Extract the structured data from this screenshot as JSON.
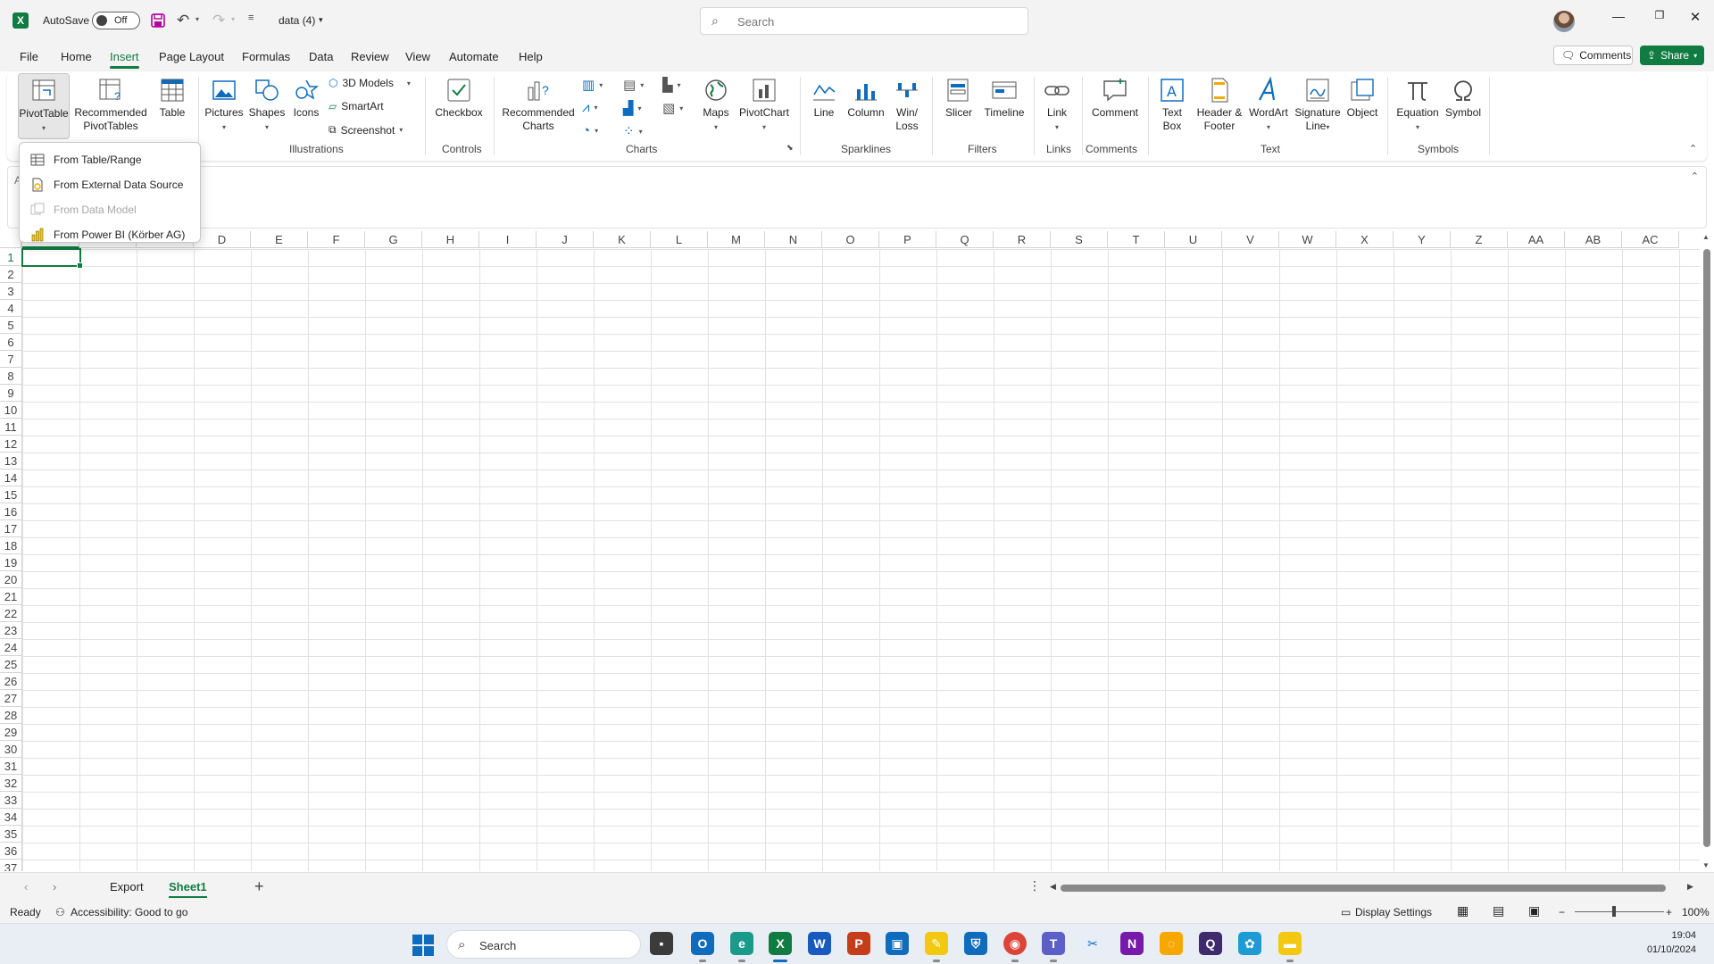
{
  "titlebar": {
    "app_icon_letter": "X",
    "autosave_label": "AutoSave",
    "autosave_state": "Off",
    "document_title": "data (4)",
    "search_placeholder": "Search"
  },
  "menu": {
    "tabs": [
      "File",
      "Home",
      "Insert",
      "Page Layout",
      "Formulas",
      "Data",
      "Review",
      "View",
      "Automate",
      "Help"
    ],
    "active_tab": "Insert",
    "comments_label": "Comments",
    "share_label": "Share"
  },
  "ribbon": {
    "tables": {
      "pivottable": "PivotTable",
      "recommended_pivottables": "Recommended PivotTables",
      "table": "Table"
    },
    "illustrations": {
      "pictures": "Pictures",
      "shapes": "Shapes",
      "icons": "Icons",
      "models_3d": "3D Models",
      "smartart": "SmartArt",
      "screenshot": "Screenshot",
      "group": "Illustrations"
    },
    "controls": {
      "checkbox": "Checkbox",
      "group": "Controls"
    },
    "charts": {
      "recommended_charts": "Recommended Charts",
      "maps": "Maps",
      "pivotchart": "PivotChart",
      "group": "Charts"
    },
    "sparklines": {
      "line": "Line",
      "column": "Column",
      "winloss": "Win/ Loss",
      "group": "Sparklines"
    },
    "filters": {
      "slicer": "Slicer",
      "timeline": "Timeline",
      "group": "Filters"
    },
    "links": {
      "link": "Link",
      "group": "Links"
    },
    "comments": {
      "comment": "Comment",
      "group": "Comments"
    },
    "text": {
      "textbox": "Text Box",
      "header_footer": "Header & Footer",
      "wordart": "WordArt",
      "signature_line": "Signature Line",
      "object": "Object",
      "group": "Text"
    },
    "symbols": {
      "equation": "Equation",
      "symbol": "Symbol",
      "group": "Symbols"
    }
  },
  "pivot_menu": {
    "items": [
      {
        "label": "From Table/Range",
        "enabled": true
      },
      {
        "label": "From External Data Source",
        "enabled": true
      },
      {
        "label": "From Data Model",
        "enabled": false
      },
      {
        "label": "From Power BI (Körber AG)",
        "enabled": true
      }
    ]
  },
  "grid": {
    "columns": [
      "D",
      "E",
      "F",
      "G",
      "H",
      "I",
      "J",
      "K",
      "L",
      "M",
      "N",
      "O",
      "P",
      "Q",
      "R",
      "S",
      "T",
      "U",
      "V",
      "W",
      "X",
      "Y",
      "Z",
      "AA",
      "AB",
      "AC"
    ],
    "rows": [
      "1",
      "2",
      "3",
      "4",
      "5",
      "6",
      "7",
      "8",
      "9",
      "10",
      "11",
      "12",
      "13",
      "14",
      "15",
      "16",
      "17",
      "18",
      "19",
      "20",
      "21",
      "22",
      "23",
      "24",
      "25",
      "26",
      "27",
      "28",
      "29",
      "30",
      "31",
      "32",
      "33",
      "34",
      "35",
      "36",
      "37"
    ],
    "selected_cell": "A1"
  },
  "sheets": {
    "tabs": [
      "Export",
      "Sheet1"
    ],
    "active": "Sheet1"
  },
  "status": {
    "ready": "Ready",
    "accessibility": "Accessibility: Good to go",
    "display_settings": "Display Settings",
    "zoom": "100%"
  },
  "taskbar": {
    "search": "Search",
    "time": "19:04",
    "date": "01/10/2024"
  },
  "colors": {
    "accent": "#107c41",
    "taskbar_accent": "#0f6cbd"
  }
}
